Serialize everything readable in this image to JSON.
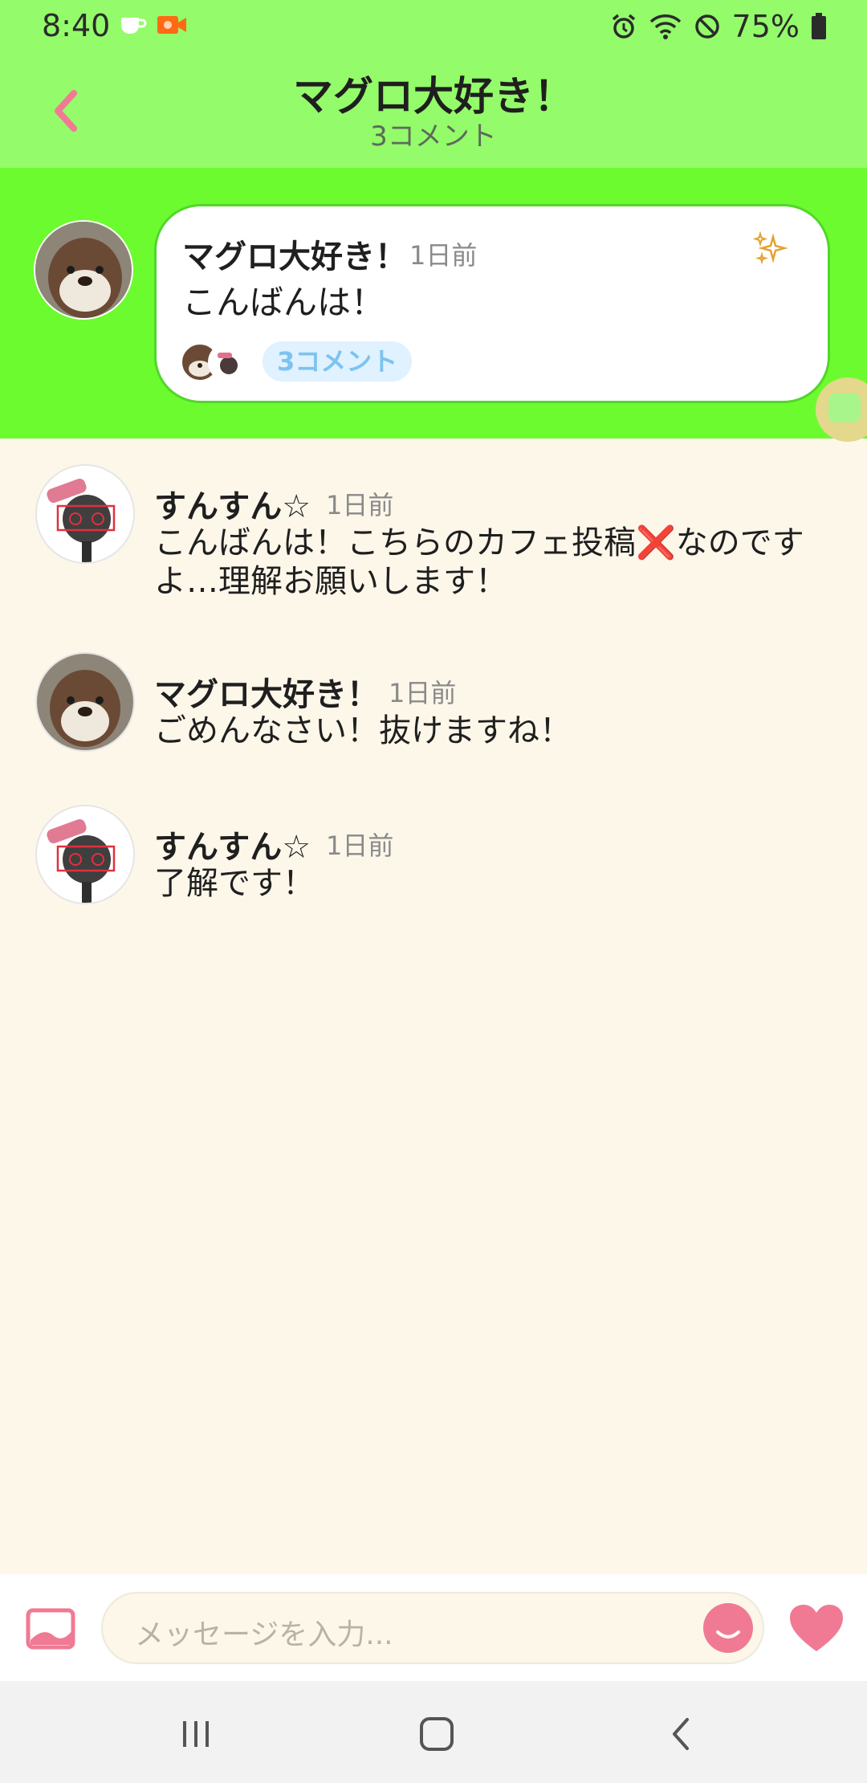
{
  "status_bar": {
    "time": "8:40",
    "battery_percent": "75%",
    "icons": [
      "coffee-icon",
      "video-camera-icon",
      "alarm-icon",
      "wifi-icon",
      "do-not-disturb-icon",
      "battery-icon"
    ]
  },
  "header": {
    "title": "マグロ大好き！",
    "subtitle": "3コメント",
    "back_icon": "chevron-left-icon"
  },
  "post": {
    "author": "マグロ大好き！",
    "time": "1日前",
    "text": "こんばんは！",
    "comment_badge": "3コメント",
    "sparkle_icon": "sparkle-icon"
  },
  "comments": [
    {
      "author": "すんすん☆",
      "time": "1日前",
      "text": "こんばんは！こちらのカフェ投稿❌なのですよ…理解お願いします！"
    },
    {
      "author": "マグロ大好き！",
      "time": "1日前",
      "text": "ごめんなさい！抜けますね！"
    },
    {
      "author": "すんすん☆",
      "time": "1日前",
      "text": "了解です！"
    }
  ],
  "input": {
    "placeholder": "メッセージを入力..."
  },
  "colors": {
    "header_bg": "#94fb6a",
    "post_area_bg": "#6cfb2e",
    "page_bg": "#fdf7ea",
    "accent_pink": "#f07a93",
    "badge_text": "#7cc3f0"
  }
}
